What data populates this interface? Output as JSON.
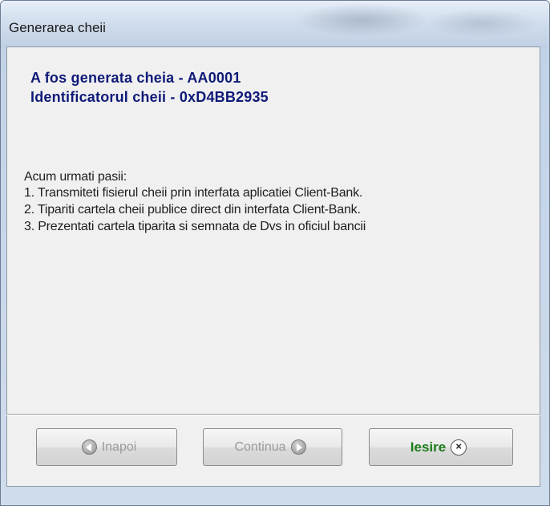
{
  "window": {
    "title": "Generarea cheii"
  },
  "header": {
    "line1": "A fos generata cheia - AA0001",
    "line2": "Identificatorul cheii - 0xD4BB2935"
  },
  "instructions": {
    "intro": "Acum urmati pasii:",
    "steps": [
      "1. Transmiteti fisierul cheii prin interfata aplicatiei Client-Bank.",
      "2. Tipariti cartela cheii publice direct din interfata Client-Bank.",
      "3. Prezentati cartela tiparita si semnata de Dvs in oficiul bancii"
    ]
  },
  "buttons": {
    "back_label": "Inapoi",
    "next_label": "Continua",
    "exit_label": "Iesire",
    "exit_symbol": "×"
  },
  "colors": {
    "heading": "#0f1a78",
    "exit_text": "#1d7d1d",
    "disabled_text": "#9a9a9a"
  },
  "icons": {
    "back": "arrow-left-circle-icon",
    "next": "arrow-right-circle-icon",
    "exit": "close-circle-icon"
  }
}
